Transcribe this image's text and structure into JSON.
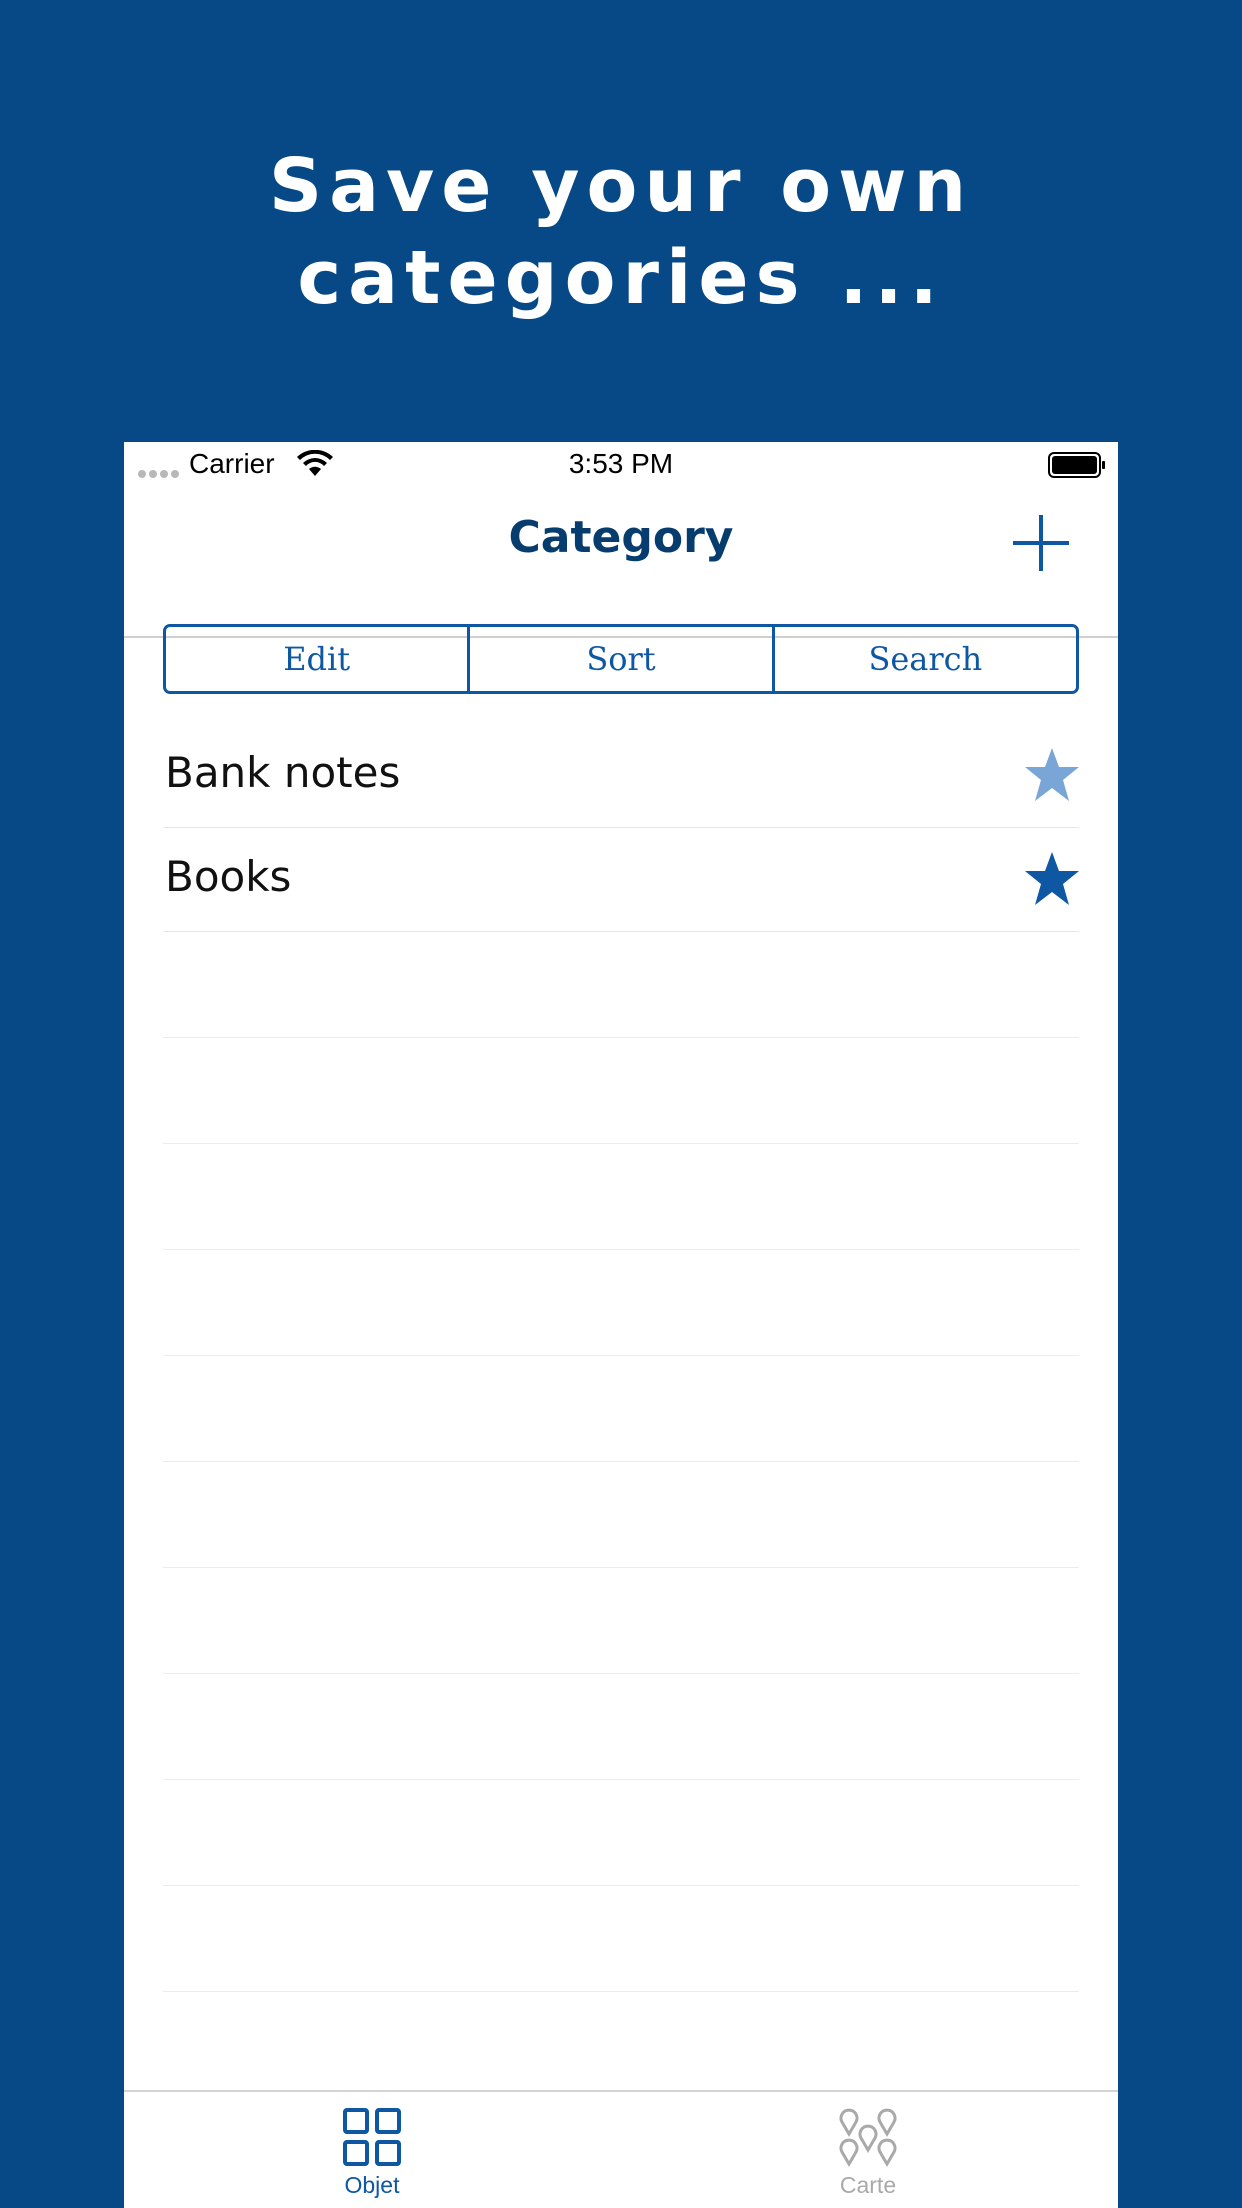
{
  "headline": {
    "line1": "Save your own",
    "line2": "categories ..."
  },
  "status_bar": {
    "carrier": "Carrier",
    "time": "3:53 PM"
  },
  "nav": {
    "title": "Category"
  },
  "segments": [
    {
      "label": "Edit"
    },
    {
      "label": "Sort"
    },
    {
      "label": "Search"
    }
  ],
  "categories": [
    {
      "label": "Bank notes",
      "star_color": "#79a6d6"
    },
    {
      "label": "Books",
      "star_color": "#0d57a3"
    }
  ],
  "tabs": [
    {
      "label": "Objet",
      "color": "#0d57a3",
      "selected": true
    },
    {
      "label": "Carte",
      "color": "#a9a9a9",
      "selected": false
    }
  ],
  "colors": {
    "background": "#074887",
    "accent": "#0d57a3",
    "title": "#063c6e"
  }
}
